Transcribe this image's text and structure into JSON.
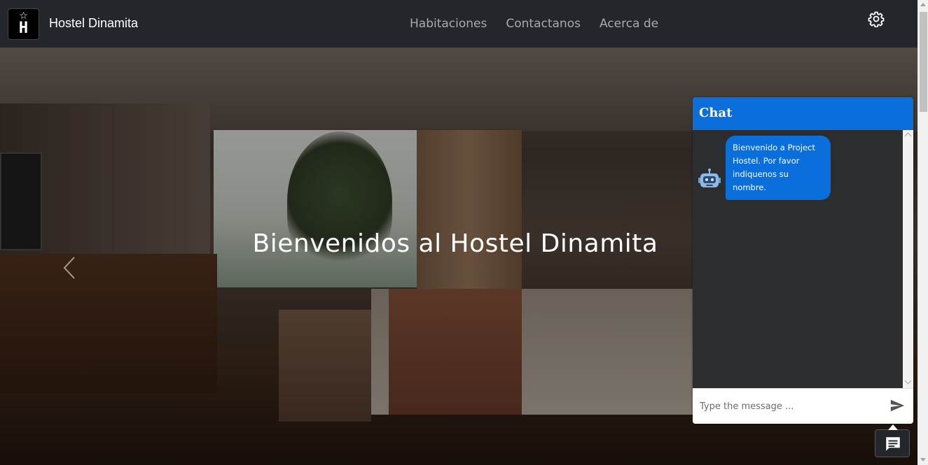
{
  "navbar": {
    "brand": "Hostel Dinamita",
    "links": [
      "Habitaciones",
      "Contactanos",
      "Acerca de"
    ]
  },
  "hero": {
    "title": "Bienvenidos al Hostel Dinamita"
  },
  "chat": {
    "title": "Chat",
    "messages": [
      {
        "from": "bot",
        "text": "Bienvenido a Project Hostel. Por favor indiquenos su nombre."
      }
    ],
    "input_placeholder": "Type the message ..."
  },
  "icons": {
    "settings": "gear-icon",
    "carousel_prev": "chevron-left-icon",
    "bot": "robot-icon",
    "send": "send-icon",
    "chat_toggle": "chat-bubble-icon"
  },
  "colors": {
    "navbar_bg": "#23272b",
    "chat_accent": "#0a6fdb",
    "chat_body": "#2c2d2f"
  }
}
